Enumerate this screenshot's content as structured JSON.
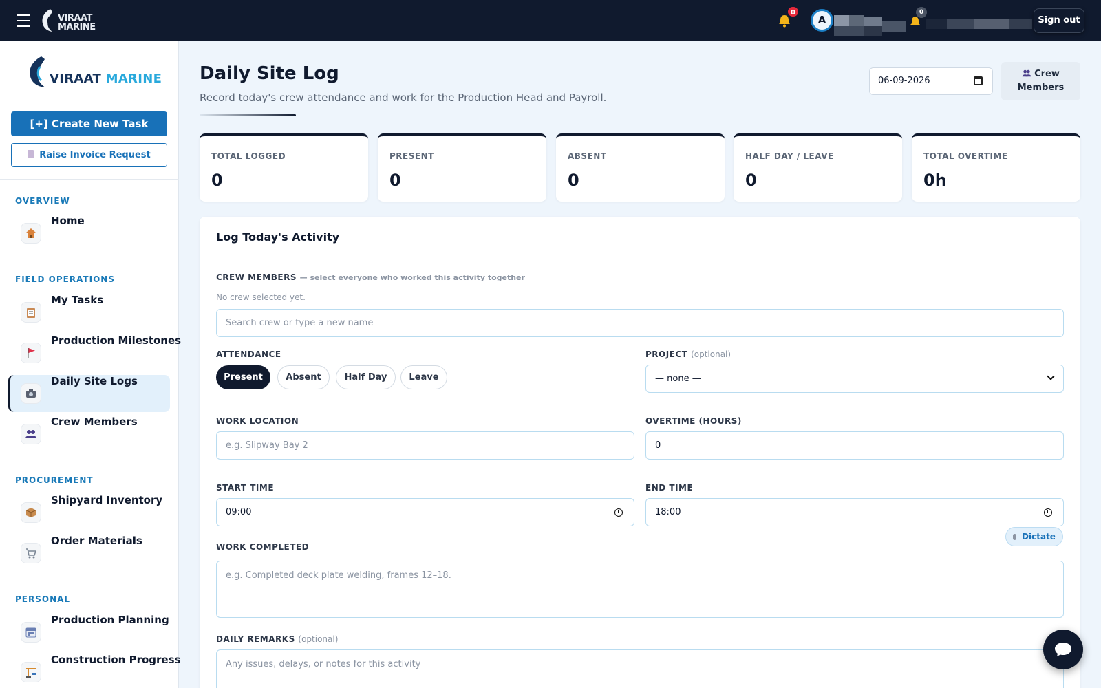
{
  "topbar": {
    "brand_line1": "VIRAAT",
    "brand_line2": "MARINE",
    "notif_count": "0",
    "avatar_initial": "A",
    "second_notif_count": "0",
    "signout_label": "Sign out"
  },
  "sidebar": {
    "brand_part1": "VIRAAT",
    "brand_part2": "MARINE",
    "create_task_label": "[+] Create New Task",
    "invoice_label": "Raise Invoice Request",
    "sections": {
      "overview": "OVERVIEW",
      "field_operations": "FIELD OPERATIONS",
      "procurement": "PROCUREMENT",
      "personal": "PERSONAL"
    },
    "items": [
      {
        "label": "Home",
        "icon": "home-icon"
      },
      {
        "label": "My Tasks",
        "icon": "clipboard-icon"
      },
      {
        "label": "Production Milestones",
        "icon": "flag-icon"
      },
      {
        "label": "Daily Site Logs",
        "icon": "camera-icon",
        "active": true
      },
      {
        "label": "Crew Members",
        "icon": "people-icon"
      },
      {
        "label": "Shipyard Inventory",
        "icon": "box-icon"
      },
      {
        "label": "Order Materials",
        "icon": "cart-icon"
      },
      {
        "label": "Production Planning",
        "icon": "calendar-icon"
      },
      {
        "label": "Construction Progress",
        "icon": "crane-icon"
      }
    ]
  },
  "header": {
    "title": "Daily Site Log",
    "subtitle": "Record today's crew attendance and work for the Production Head and Payroll.",
    "date_value": "06-09-2026",
    "crew_button_label_line1": "Crew",
    "crew_button_label_line2": "Members"
  },
  "stats": [
    {
      "label": "TOTAL LOGGED",
      "value": "0"
    },
    {
      "label": "PRESENT",
      "value": "0"
    },
    {
      "label": "ABSENT",
      "value": "0"
    },
    {
      "label": "HALF DAY / LEAVE",
      "value": "0"
    },
    {
      "label": "TOTAL OVERTIME",
      "value": "0h"
    }
  ],
  "form": {
    "title": "Log Today's Activity",
    "crew_label": "CREW MEMBERS",
    "crew_hint": "— select everyone who worked this activity together",
    "crew_empty": "No crew selected yet.",
    "crew_search_placeholder": "Search crew or type a new name",
    "attendance_label": "ATTENDANCE",
    "attendance_options": [
      "Present",
      "Absent",
      "Half Day",
      "Leave"
    ],
    "attendance_selected": "Present",
    "project_label": "PROJECT",
    "project_optional": "(optional)",
    "project_value": "— none —",
    "work_location_label": "WORK LOCATION",
    "work_location_placeholder": "e.g. Slipway Bay 2",
    "overtime_label": "OVERTIME (HOURS)",
    "overtime_value": "0",
    "start_time_label": "START TIME",
    "start_time_value": "09:00",
    "end_time_label": "END TIME",
    "end_time_value": "18:00",
    "work_completed_label": "WORK COMPLETED",
    "dictate_label": "Dictate",
    "work_completed_placeholder": "e.g. Completed deck plate welding, frames 12–18.",
    "remarks_label": "DAILY REMARKS",
    "remarks_optional": "(optional)",
    "remarks_placeholder": "Any issues, delays, or notes for this activity"
  },
  "colors": {
    "navy": "#101a2e",
    "primary_blue": "#1871b8",
    "accent_cyan": "#29a9dc",
    "notification_red": "#e5293b"
  }
}
